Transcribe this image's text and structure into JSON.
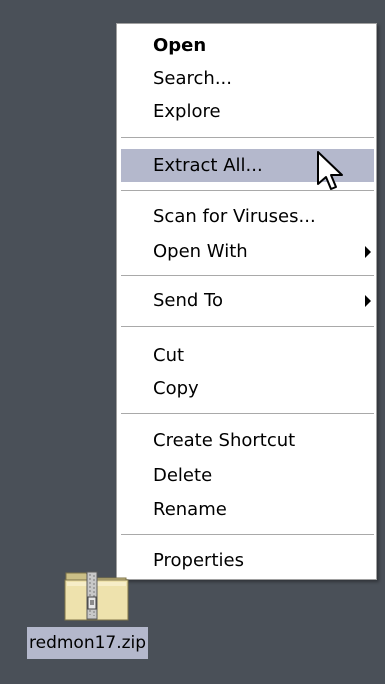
{
  "context_menu": {
    "items": [
      {
        "label": "Open",
        "bold": true
      },
      {
        "label": "Search..."
      },
      {
        "label": "Explore"
      },
      {
        "label": "Extract All...",
        "highlighted": true
      },
      {
        "label": "Scan for Viruses..."
      },
      {
        "label": "Open With",
        "submenu": true
      },
      {
        "label": "Send To",
        "submenu": true
      },
      {
        "label": "Cut"
      },
      {
        "label": "Copy"
      },
      {
        "label": "Create Shortcut"
      },
      {
        "label": "Delete"
      },
      {
        "label": "Rename"
      },
      {
        "label": "Properties"
      }
    ]
  },
  "desktop_icon": {
    "label": "redmon17.zip",
    "icon": "zip-folder-icon"
  },
  "colors": {
    "desktop_background": "#4a5058",
    "menu_background": "#ffffff",
    "highlight": "#b4b8cc"
  }
}
